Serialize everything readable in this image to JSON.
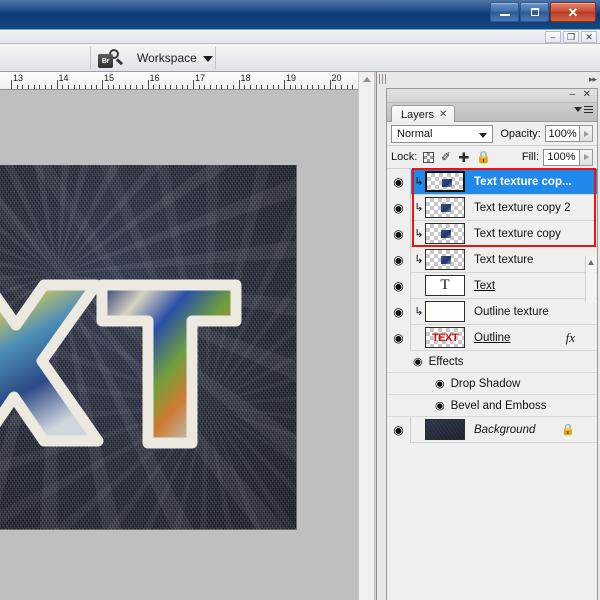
{
  "os_window": {
    "minimize_label": "–",
    "maximize_label": "❐",
    "close_label": "✕"
  },
  "document_window": {
    "minimize_label": "–",
    "restore_label": "❐",
    "close_label": "✕"
  },
  "options_bar": {
    "bridge_icon_label": "Br",
    "workspace_label": "Workspace",
    "workspace_caret": "▼"
  },
  "ruler": {
    "unit": "inches",
    "ticks": [
      "13",
      "14",
      "15",
      "16",
      "17",
      "18",
      "19",
      "20"
    ]
  },
  "canvas": {
    "background_description": "dark denim texture",
    "letters": "XT"
  },
  "panel": {
    "minimize_label": "–",
    "close_label": "✕",
    "tab_label": "Layers",
    "tab_close": "✕",
    "blend_mode": "Normal",
    "blend_caret": "▼",
    "opacity_label": "Opacity:",
    "opacity_value": "100%",
    "lock_label": "Lock:",
    "fill_label": "Fill:",
    "fill_value": "100%",
    "lock_icons": [
      "lock-transparent-pixels",
      "lock-image-pixels",
      "lock-position",
      "lock-all"
    ]
  },
  "layers": [
    {
      "name": "Text texture cop...",
      "visible": true,
      "selected": true,
      "clipped": true,
      "thumb": "checker",
      "style": "normal",
      "in_red_box": true
    },
    {
      "name": "Text texture copy 2",
      "visible": true,
      "selected": false,
      "clipped": true,
      "thumb": "checker",
      "style": "normal",
      "in_red_box": true
    },
    {
      "name": "Text texture copy",
      "visible": true,
      "selected": false,
      "clipped": true,
      "thumb": "checker",
      "style": "normal",
      "in_red_box": true
    },
    {
      "name": "Text texture",
      "visible": true,
      "selected": false,
      "clipped": true,
      "thumb": "checker",
      "style": "normal",
      "in_red_box": false
    },
    {
      "name": "Text",
      "visible": true,
      "selected": false,
      "clipped": false,
      "thumb": "type-T",
      "thumb_glyph": "T",
      "style": "underline",
      "in_red_box": false
    },
    {
      "name": "Outline texture",
      "visible": true,
      "selected": false,
      "clipped": true,
      "thumb": "white",
      "style": "normal",
      "in_red_box": false
    },
    {
      "name": "Outline",
      "visible": true,
      "selected": false,
      "clipped": false,
      "thumb": "text-red",
      "thumb_glyph": "TEXT",
      "style": "underline",
      "fx_label": "fx",
      "in_red_box": false
    }
  ],
  "effects": {
    "group_label": "Effects",
    "items": [
      "Drop Shadow",
      "Bevel and Emboss"
    ]
  },
  "background_layer": {
    "name": "Background",
    "visible": true,
    "locked": true,
    "lock_glyph": "ὑ2"
  },
  "icons": {
    "eye": "◉",
    "clip_arrow": "↳",
    "lock_closed": "▯",
    "scroll_up": "▲"
  },
  "colors": {
    "selection_blue": "#1f8aeb",
    "red_highlight": "#ee1111",
    "panel_bg": "#efefef",
    "titlebar_blue": "#10407f",
    "denim": "#252a3a"
  }
}
